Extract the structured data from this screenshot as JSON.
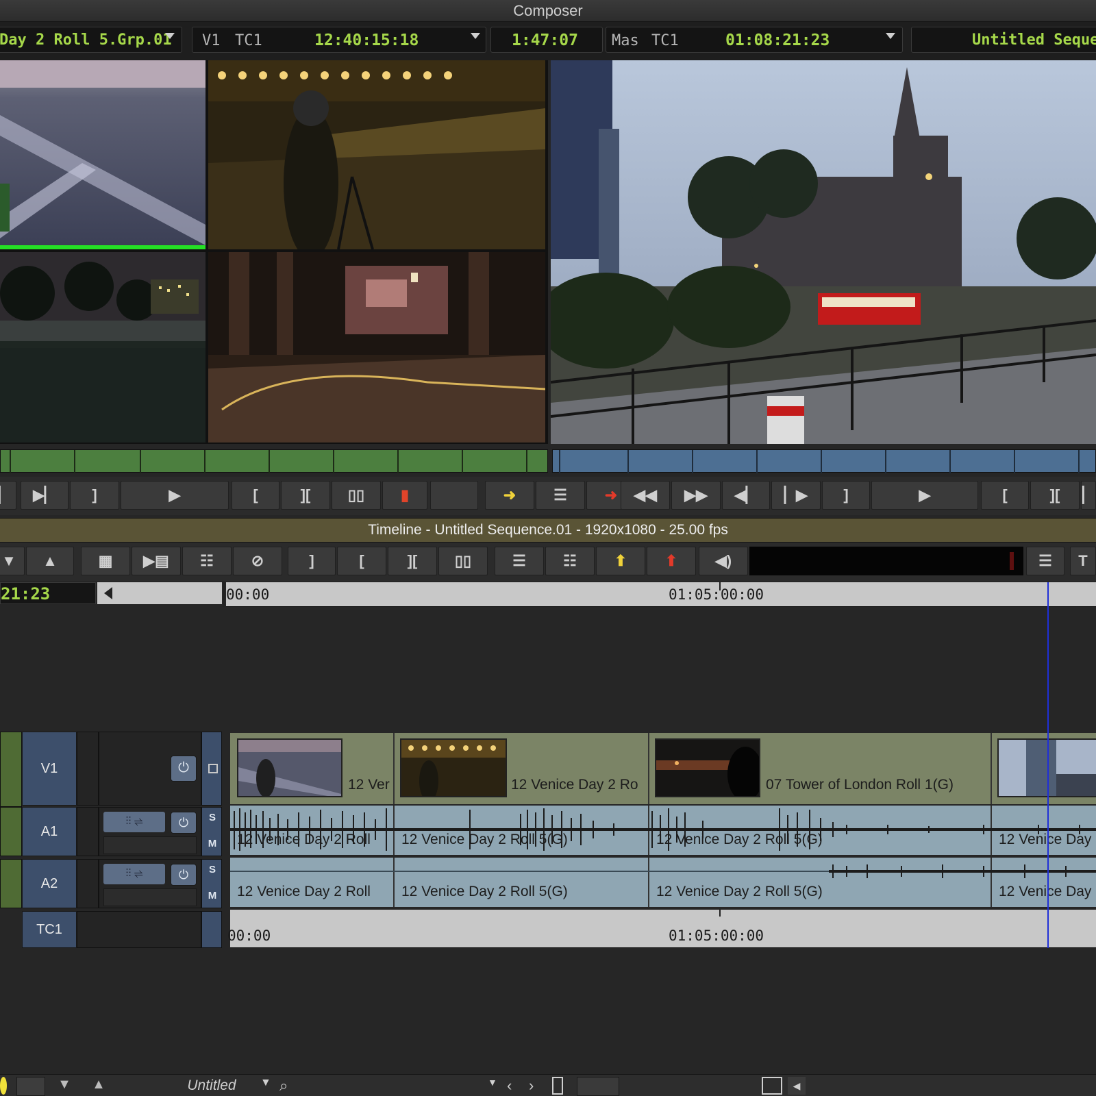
{
  "window": {
    "title": "Composer"
  },
  "source_monitor": {
    "clip_name": "Day 2 Roll 5.Grp.01",
    "track": "V1",
    "tc_label": "TC1",
    "timecode": "12:40:15:18",
    "duration": "1:47:07"
  },
  "record_monitor": {
    "track": "Mas",
    "tc_label": "TC1",
    "timecode": "01:08:21:23",
    "sequence_name": "Untitled Seque"
  },
  "timeline": {
    "title": "Timeline - Untitled Sequence.01 - 1920x1080 - 25.00 fps",
    "position_tc": "21:23",
    "ruler_start": "00:00",
    "ruler_mark": "01:05:00:00",
    "tracks": [
      {
        "label": "V1"
      },
      {
        "label": "A1",
        "solo": "S",
        "mute": "M"
      },
      {
        "label": "A2",
        "solo": "S",
        "mute": "M"
      },
      {
        "label": "TC1"
      }
    ],
    "video_clips": [
      {
        "name": "12 Ver"
      },
      {
        "name": "12 Venice Day 2 Ro"
      },
      {
        "name": "07 Tower of London Roll 1(G)"
      },
      {
        "name": ""
      }
    ],
    "a1_clips": [
      {
        "name": "12 Venice Day 2 Roll"
      },
      {
        "name": "12 Venice Day 2 Roll 5(G)"
      },
      {
        "name": "12 Venice Day 2 Roll 5(G)"
      },
      {
        "name": "12 Venice Day"
      }
    ],
    "a2_clips": [
      {
        "name": "12 Venice Day 2 Roll"
      },
      {
        "name": "12 Venice Day 2 Roll 5(G)"
      },
      {
        "name": "12 Venice Day 2 Roll 5(G)"
      },
      {
        "name": "12 Venice Day"
      }
    ],
    "tc_track_start": "00:00",
    "tc_track_mark": "01:05:00:00"
  },
  "bottom_bar": {
    "bin_name": "Untitled"
  },
  "colors": {
    "timecode_green": "#a6d84a",
    "source_bar_green": "#4c7f3f",
    "record_bar_blue": "#4d6f93",
    "playhead": "#1f2fd6",
    "video_clip": "#7b8466",
    "audio_clip": "#8fa6b3",
    "track_label": "#3d4f6b"
  }
}
